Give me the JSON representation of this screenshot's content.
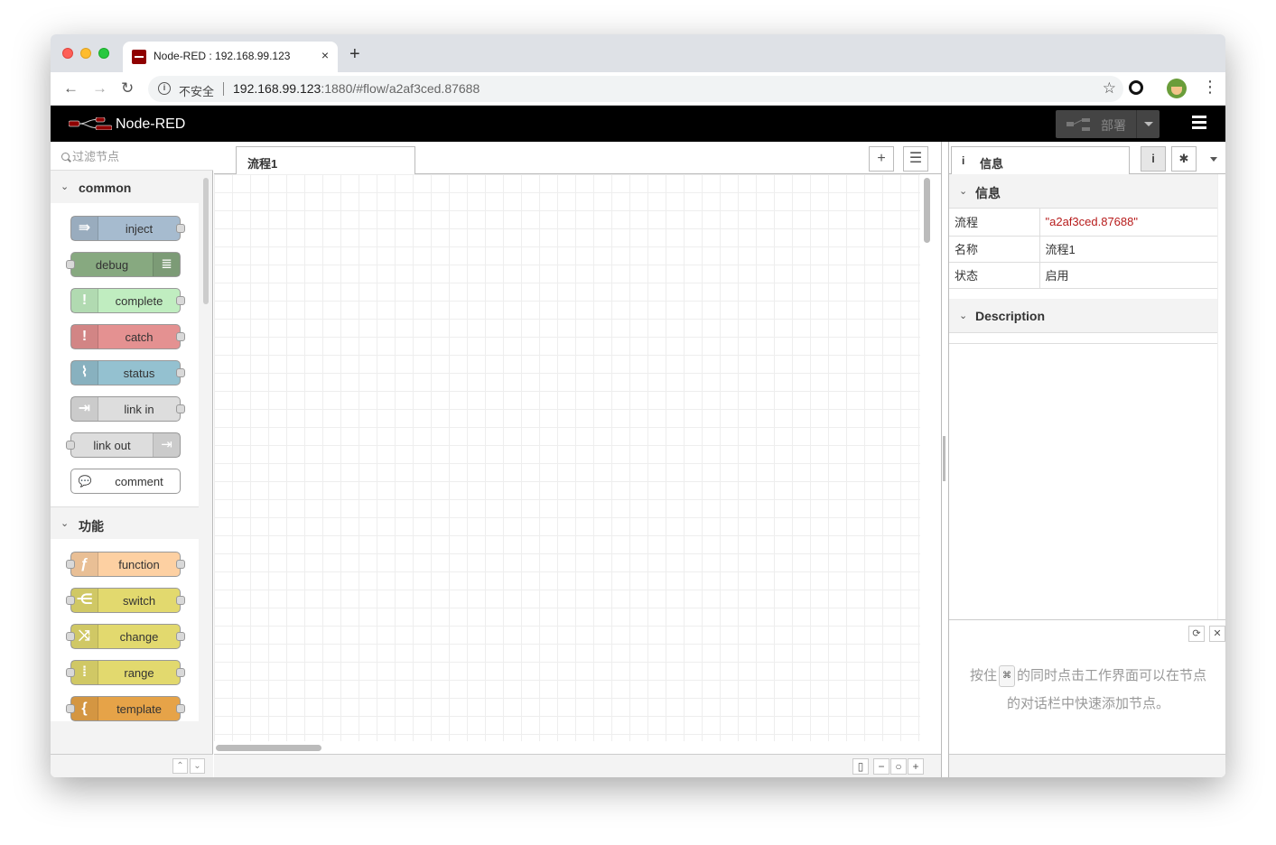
{
  "browser": {
    "tab_title": "Node-RED : 192.168.99.123",
    "tab_close": "×",
    "new_tab": "+",
    "security_label": "不安全",
    "url_host": "192.168.99.123",
    "url_rest": ":1880/#flow/a2af3ced.87688"
  },
  "header": {
    "app_title": "Node-RED",
    "deploy_label": "部署"
  },
  "palette": {
    "search_placeholder": "过滤节点",
    "categories": [
      {
        "label": "common",
        "nodes": [
          {
            "label": "inject",
            "color": "#a6bbcf",
            "icon": "inject-icon",
            "glyph": "⇛"
          },
          {
            "label": "debug",
            "color": "#87a980",
            "icon": "debug-icon",
            "glyph": "≣"
          },
          {
            "label": "complete",
            "color": "#c0edc0",
            "icon": "exclamation-icon",
            "glyph": "!"
          },
          {
            "label": "catch",
            "color": "#e49191",
            "icon": "exclamation-icon",
            "glyph": "!"
          },
          {
            "label": "status",
            "color": "#94c1d0",
            "icon": "pulse-icon",
            "glyph": "⌇"
          },
          {
            "label": "link in",
            "color": "#dddddd",
            "icon": "link-icon",
            "glyph": "⇥"
          },
          {
            "label": "link out",
            "color": "#dddddd",
            "icon": "link-icon",
            "glyph": "⇥"
          },
          {
            "label": "comment",
            "color": "#ffffff",
            "icon": "comment-icon",
            "glyph": "💬"
          }
        ]
      },
      {
        "label": "功能",
        "nodes": [
          {
            "label": "function",
            "color": "#fdd0a2",
            "icon": "function-icon",
            "glyph": "ƒ"
          },
          {
            "label": "switch",
            "color": "#e2d96e",
            "icon": "switch-icon",
            "glyph": "⋲"
          },
          {
            "label": "change",
            "color": "#e2d96e",
            "icon": "shuffle-icon",
            "glyph": "⤨"
          },
          {
            "label": "range",
            "color": "#e2d96e",
            "icon": "range-icon",
            "glyph": "⁞"
          },
          {
            "label": "template",
            "color": "#e6a348",
            "icon": "brace-icon",
            "glyph": "{"
          }
        ]
      }
    ]
  },
  "workspace": {
    "flow_tab_label": "流程1",
    "add_tab_glyph": "+",
    "list_glyph": "☰"
  },
  "sidebar": {
    "tab_label": "信息",
    "tab_icon": "i",
    "info_section_label": "信息",
    "info_rows": [
      {
        "key": "流程",
        "value": "\"a2af3ced.87688\""
      },
      {
        "key": "名称",
        "value": "流程1"
      },
      {
        "key": "状态",
        "value": "启用"
      }
    ],
    "description_label": "Description",
    "tip_before": "按住",
    "tip_key": "⌘",
    "tip_after": "的同时点击工作界面可以在节点的对话栏中快速添加节点。"
  },
  "colors": {
    "header_bg": "#000000",
    "deploy_bg": "#444444",
    "flow_id_red": "#b71c1c"
  }
}
